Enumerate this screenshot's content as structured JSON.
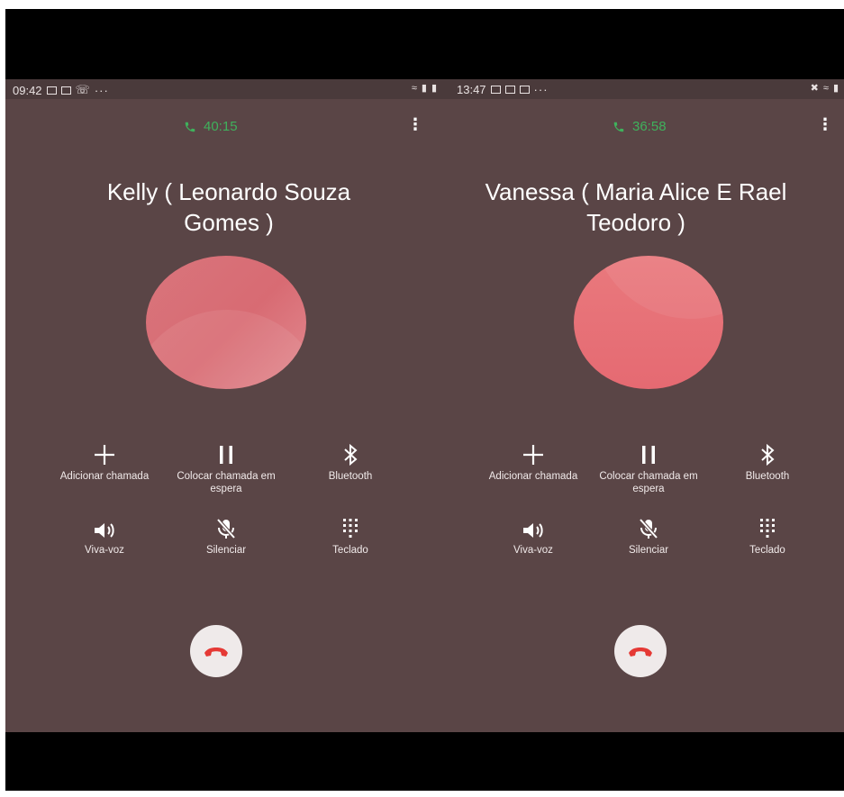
{
  "left": {
    "status_time": "09:42",
    "timer": "40:15",
    "caller_name": "Kelly ( Leonardo Souza Gomes )",
    "controls": {
      "add_call": "Adicionar chamada",
      "hold": "Colocar chamada em espera",
      "bluetooth": "Bluetooth",
      "speaker": "Viva-voz",
      "mute": "Silenciar",
      "keypad": "Teclado"
    }
  },
  "right": {
    "status_time": "13:47",
    "timer": "36:58",
    "caller_name": "Vanessa ( Maria Alice E Rael Teodoro )",
    "controls": {
      "add_call": "Adicionar chamada",
      "hold": "Colocar chamada em espera",
      "bluetooth": "Bluetooth",
      "speaker": "Viva-voz",
      "mute": "Silenciar",
      "keypad": "Teclado"
    }
  },
  "colors": {
    "background": "#5a4546",
    "timer_green": "#3fb15c",
    "hangup_red": "#e53935",
    "avatar_pink": "#e0707a"
  },
  "icons": [
    "phone-icon",
    "more-vert-icon",
    "plus-icon",
    "pause-icon",
    "bluetooth-icon",
    "speaker-icon",
    "mic-off-icon",
    "dialpad-icon",
    "call-end-icon"
  ]
}
